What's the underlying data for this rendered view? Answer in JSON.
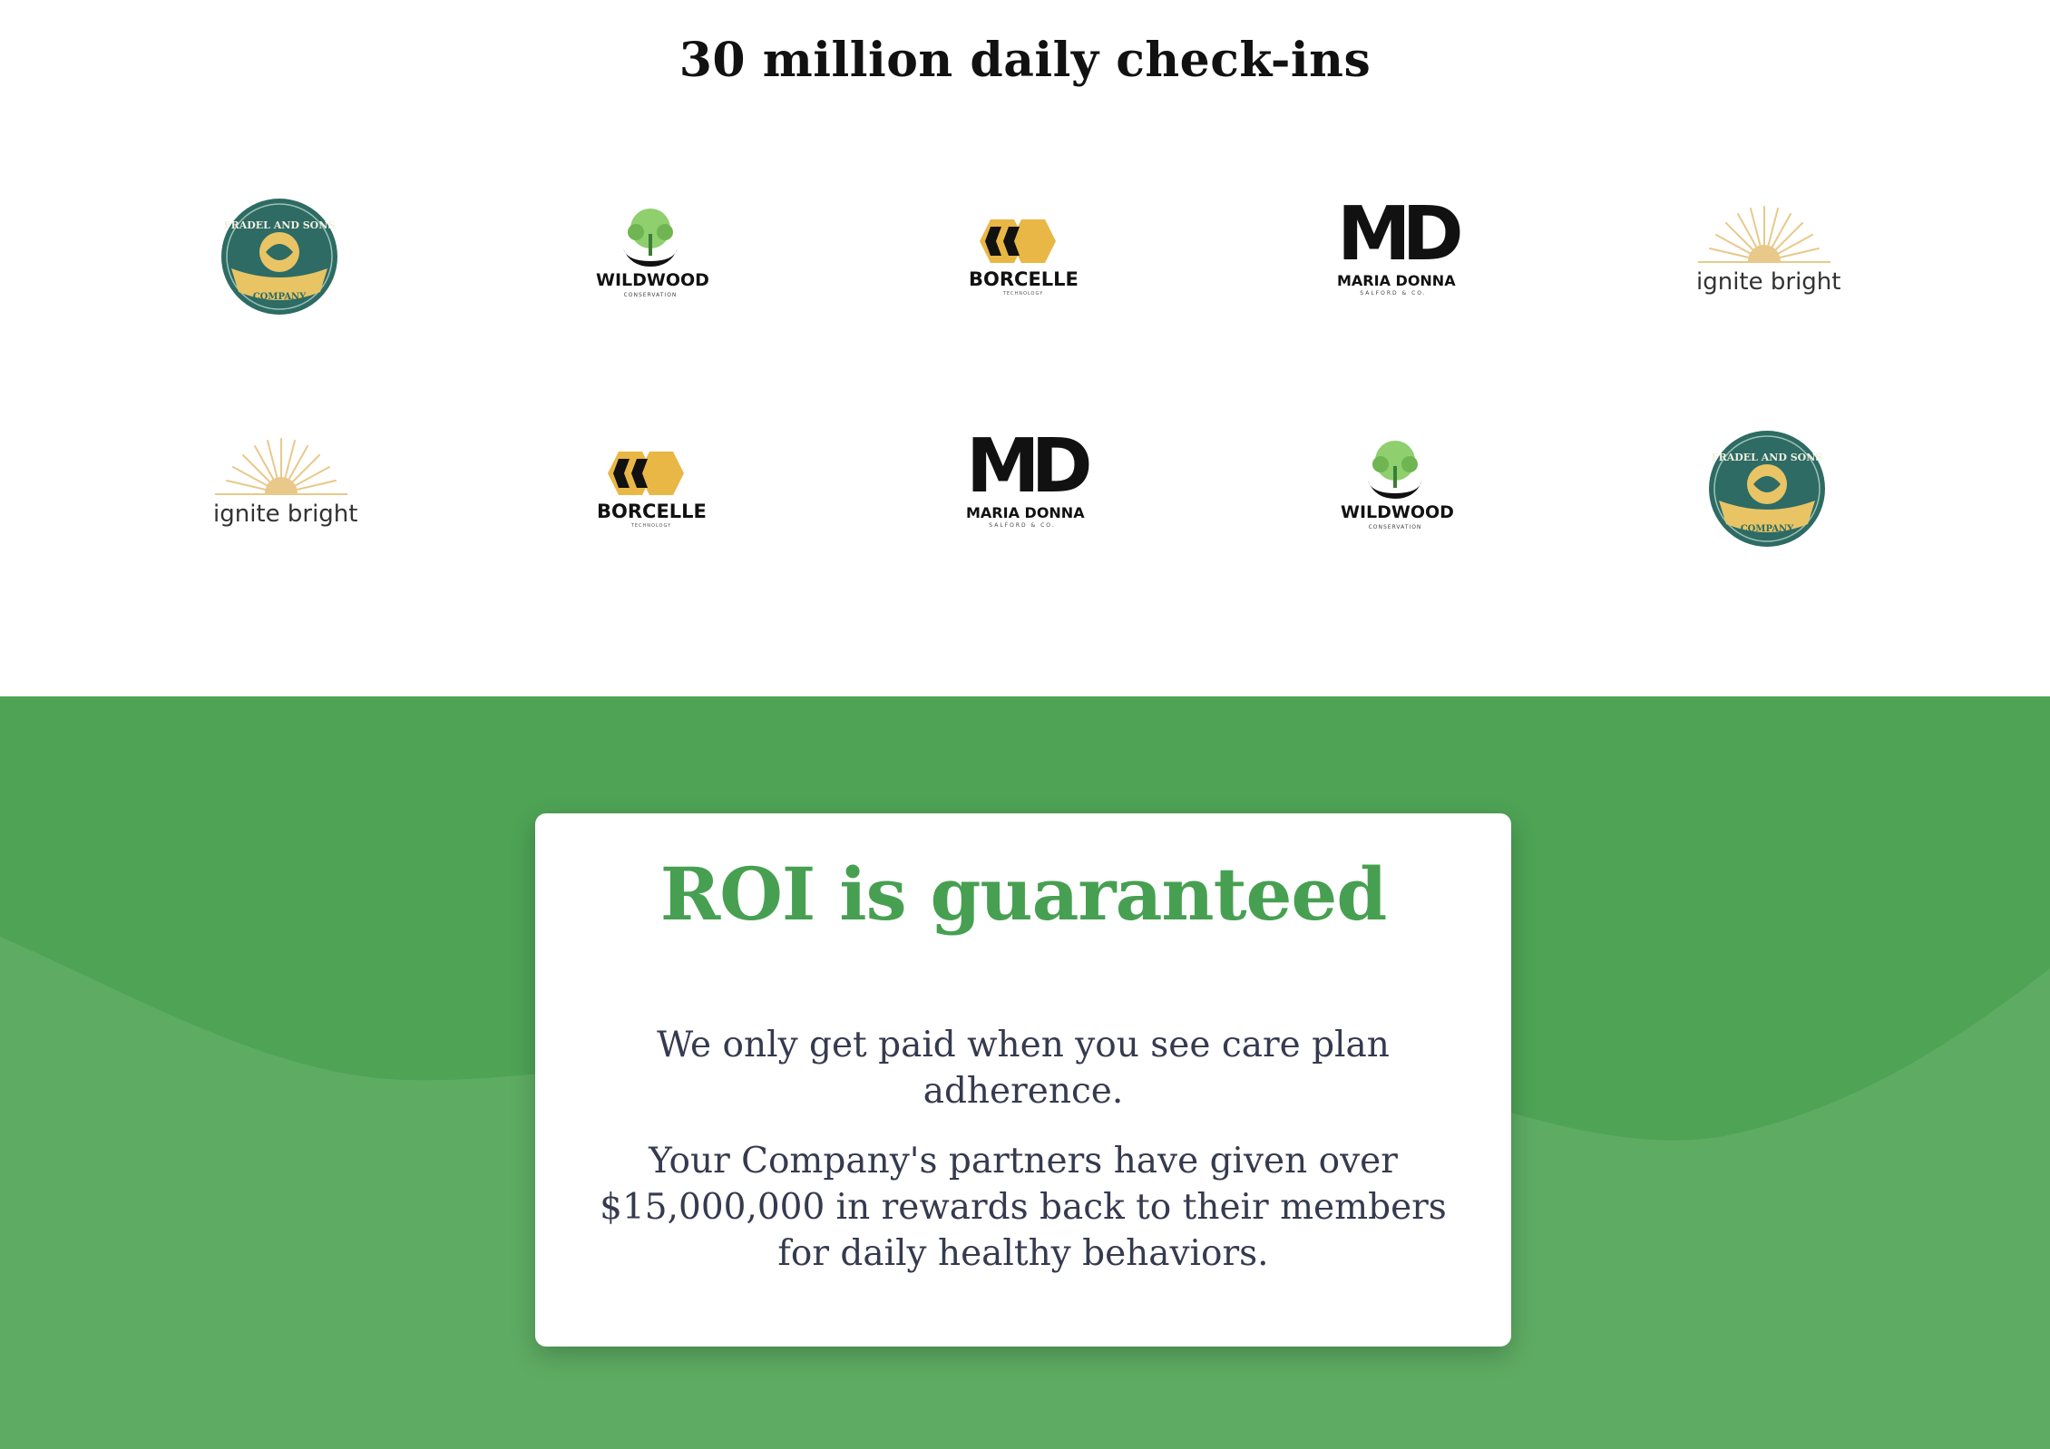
{
  "headline": "30 million daily check-ins",
  "logos": {
    "fradel": {
      "line1": "FRADEL AND SONS",
      "line2": "COMPANY"
    },
    "wildwood": {
      "name": "WILDWOOD",
      "sub": "CONSERVATION"
    },
    "borcelle": {
      "name": "BORCELLE",
      "sub": "TECHNOLOGY"
    },
    "maria_donna": {
      "mark": "MD",
      "name": "MARIA DONNA",
      "sub": "SALFORD & CO."
    },
    "ignite": {
      "name": "ignite bright"
    }
  },
  "card": {
    "title": "ROI is guaranteed",
    "paragraph1": "We only get paid when you see care plan adherence.",
    "paragraph2": "Your Company's partners have given over $15,000,000 in rewards back to their members for daily healthy behaviors."
  },
  "colors": {
    "green_dark": "#4ea355",
    "green_light": "#5eac63",
    "title_green": "#47a052",
    "teal": "#2d6b64",
    "gold": "#e9b745",
    "sunburst": "#e8c98a"
  }
}
